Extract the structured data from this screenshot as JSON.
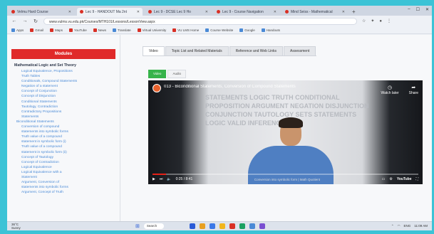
{
  "browser": {
    "tabs": [
      {
        "title": "Velmu Hard Course",
        "color": "#d93025",
        "active": false
      },
      {
        "title": "Lec 9 - HANDOUT Ma 2nt",
        "color": "#d93025",
        "active": true
      },
      {
        "title": "Lec 9 - DCSE Lec 9 Ho",
        "color": "#d93025",
        "active": false
      },
      {
        "title": "Lec 9 - Course Navigation",
        "color": "#d93025",
        "active": false
      },
      {
        "title": "Mind Seiss - Mathematical",
        "color": "#d93025",
        "active": false
      }
    ],
    "new_tab": "+",
    "window_controls": [
      "–",
      "☐",
      "✕"
    ],
    "url": "www.vulms.vu.edu.pk/Courses/MTH101/Lessons/LessonView.aspx",
    "bookmarks": [
      {
        "label": "Apps",
        "color": "#4a8ad6"
      },
      {
        "label": "Gmail",
        "color": "#d93025"
      },
      {
        "label": "Maps",
        "color": "#d93025"
      },
      {
        "label": "YouTube",
        "color": "#d93025"
      },
      {
        "label": "News",
        "color": "#d93025"
      },
      {
        "label": "Translate",
        "color": "#4a8ad6"
      },
      {
        "label": "Virtual University",
        "color": "#d93025"
      },
      {
        "label": "VU LMS Home",
        "color": "#d93025"
      },
      {
        "label": "Course Website",
        "color": "#4a8ad6"
      },
      {
        "label": "Google",
        "color": "#4a8ad6"
      },
      {
        "label": "Handouts",
        "color": "#4a8ad6"
      }
    ]
  },
  "sidebar": {
    "header": "Modules",
    "section": "Mathematical Logic and Set Theory",
    "items": [
      {
        "label": "Logical Equivalence, Propositions",
        "sec": false
      },
      {
        "label": "Truth Tables",
        "sec": false
      },
      {
        "label": "Conditionals, Compound Statements",
        "sec": false
      },
      {
        "label": "Negation of a statement",
        "sec": false
      },
      {
        "label": "Concept of Conjunction",
        "sec": false
      },
      {
        "label": "Concept of Disjunction",
        "sec": false
      },
      {
        "label": "Conditional Statements",
        "sec": false
      },
      {
        "label": "Tautology, Contradiction",
        "sec": false
      },
      {
        "label": "Contradictory Propositions",
        "sec": false
      },
      {
        "label": "Statements",
        "sec": false
      },
      {
        "label": "Biconditional Statements",
        "sec": true
      },
      {
        "label": "Conversion of compound",
        "sec": false
      },
      {
        "label": "statements into symbolic forms",
        "sec": false
      },
      {
        "label": "Truth value of a compound",
        "sec": false
      },
      {
        "label": "statement in symbolic form (i)",
        "sec": false
      },
      {
        "label": "Truth value of a compound",
        "sec": false
      },
      {
        "label": "statement in symbolic form (ii)",
        "sec": false
      },
      {
        "label": "Concept of Tautology",
        "sec": false
      },
      {
        "label": "Concept of Contradiction",
        "sec": false
      },
      {
        "label": "Logical Equivalence",
        "sec": false
      },
      {
        "label": "Logical Equivalence with a",
        "sec": false
      },
      {
        "label": "Statement",
        "sec": false
      },
      {
        "label": "Argument, Conversion of",
        "sec": false
      },
      {
        "label": "statements into symbolic forms",
        "sec": false
      },
      {
        "label": "Argument, Concept of Truth",
        "sec": false
      }
    ]
  },
  "content": {
    "tabs": [
      {
        "label": "Video",
        "active": true
      },
      {
        "label": "Topic List and Related Materials",
        "active": false
      },
      {
        "label": "Reference and Web Links",
        "active": false
      },
      {
        "label": "Assessment",
        "active": false
      }
    ],
    "pills": [
      {
        "label": "Video",
        "active": true
      },
      {
        "label": "Audio",
        "active": false
      }
    ]
  },
  "video": {
    "title": "013 - Biconditional Statements, Conversion of Compound Statements",
    "wordcloud": "STATEMENTS LOGIC TRUTH CONDITIONAL PROPOSITION ARGUMENT NEGATION DISJUNCTION CONJUNCTION TAUTOLOGY SETS STATEMENTS LOGIC VALID INFERENCE",
    "watch_later": "Watch later",
    "share": "Share",
    "time": "0:25 / 8:41",
    "progress": 0.05,
    "caption": "Conversion into symbolic form | Math Quotient",
    "youtube": "YouTube"
  },
  "taskbar": {
    "weather_temp": "36°C",
    "weather_desc": "Sunny",
    "search": "Search",
    "apps": [
      "#2a5bd7",
      "#e8a020",
      "#3b78e7",
      "#f2b61d",
      "#d93025",
      "#1ba162",
      "#4a8ad6",
      "#7a4fd1"
    ],
    "tray": "ENG",
    "time": "11:09 AM"
  }
}
